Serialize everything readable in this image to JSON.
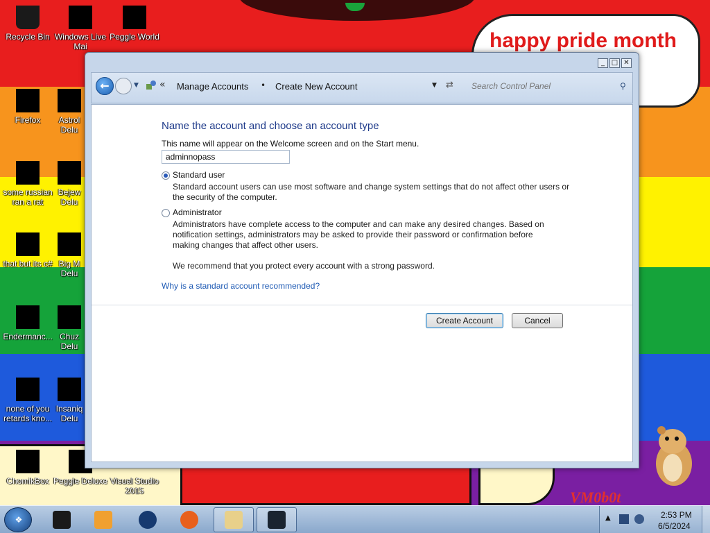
{
  "desktop": {
    "banner_text": "happy pride month",
    "watermark": "VM0b0t",
    "icons": [
      {
        "label": "Recycle Bin"
      },
      {
        "label": "Windows Live Mai"
      },
      {
        "label": "Peggle World"
      },
      {
        "label": "Firefox"
      },
      {
        "label": "Astrol Delu"
      },
      {
        "label": "some russian ran a rat"
      },
      {
        "label": "Bejew Delu"
      },
      {
        "label": "that but its c#"
      },
      {
        "label": "Big M Delu"
      },
      {
        "label": "Endermanc..."
      },
      {
        "label": "Chuz Delu"
      },
      {
        "label": "none of you retards kno..."
      },
      {
        "label": "Insaniq Delu"
      },
      {
        "label": "ChomikBox"
      },
      {
        "label": "Peggle Deluxe"
      },
      {
        "label": "Visual Studio 2015"
      }
    ]
  },
  "window": {
    "breadcrumb": {
      "item1": "Manage Accounts",
      "separator": "•",
      "item2": "Create New Account"
    },
    "search": {
      "placeholder": "Search Control Panel",
      "value": ""
    },
    "controls": {
      "minimize": "_",
      "maximize": "□",
      "close": "✕"
    },
    "content": {
      "heading": "Name the account and choose an account type",
      "subtitle": "This name will appear on the Welcome screen and on the Start menu.",
      "account_name": "adminnopass",
      "options": [
        {
          "label": "Standard user",
          "checked": true,
          "description_line1": "Standard account users can use most software and change system settings that do not affect other users or",
          "description_line2": "the security of the computer."
        },
        {
          "label": "Administrator",
          "checked": false,
          "description_line1": "Administrators have complete access to the computer and can make any desired changes. Based on",
          "description_line2": "notification settings, administrators may be asked to provide their password or confirmation before",
          "description_line3": "making changes that affect other users."
        }
      ],
      "recommendation": "We recommend that you protect every account with a strong password.",
      "link": "Why is a standard account recommended?",
      "create_button": "Create Account",
      "cancel_button": "Cancel"
    }
  },
  "taskbar": {
    "time": "2:53 PM",
    "date": "6/5/2024"
  },
  "colors": {
    "heading": "#1e3a8a",
    "link": "#1e5ab4"
  }
}
